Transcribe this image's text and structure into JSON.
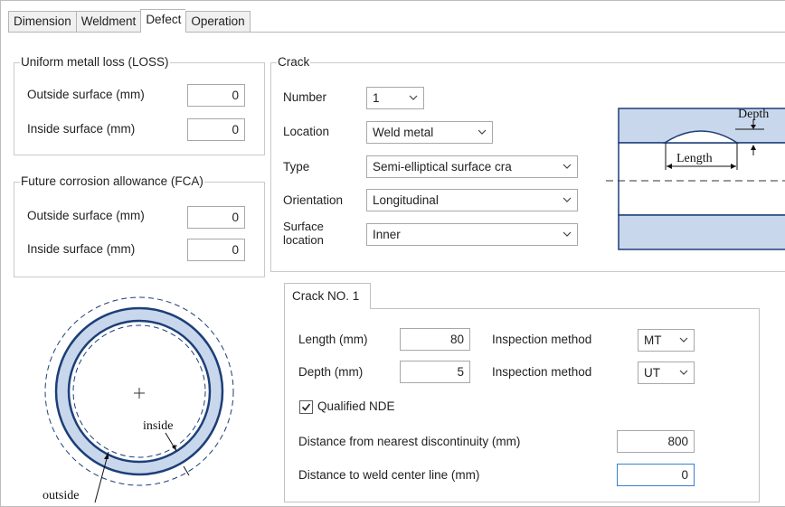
{
  "tabs": [
    "Dimension",
    "Weldment",
    "Defect",
    "Operation"
  ],
  "active_tab": "Defect",
  "loss": {
    "title": "Uniform metall loss (LOSS)",
    "outside_label": "Outside surface (mm)",
    "outside_value": "0",
    "inside_label": "Inside surface (mm)",
    "inside_value": "0"
  },
  "fca": {
    "title": "Future corrosion allowance (FCA)",
    "outside_label": "Outside surface (mm)",
    "outside_value": "0",
    "inside_label": "Inside surface (mm)",
    "inside_value": "0"
  },
  "crack": {
    "title": "Crack",
    "number_label": "Number",
    "number_value": "1",
    "location_label": "Location",
    "location_value": "Weld metal",
    "type_label": "Type",
    "type_value": "Semi-elliptical surface cra",
    "orientation_label": "Orientation",
    "orientation_value": "Longitudinal",
    "surface_label_1": "Surface",
    "surface_label_2": "location",
    "surface_value": "Inner"
  },
  "diagram": {
    "depth_label": "Depth",
    "length_label": "Length",
    "inside_label": "inside",
    "outside_label": "outside"
  },
  "crack_no": {
    "tab_label": "Crack NO. 1",
    "length_label": "Length (mm)",
    "length_value": "80",
    "depth_label": "Depth (mm)",
    "depth_value": "5",
    "inspection_label_1": "Inspection method",
    "inspection_value_1": "MT",
    "inspection_label_2": "Inspection method",
    "inspection_value_2": "UT",
    "qualified_label": "Qualified NDE",
    "qualified_checked": true,
    "discontinuity_label": "Distance from nearest discontinuity (mm)",
    "discontinuity_value": "800",
    "weld_distance_label": "Distance to weld center line (mm)",
    "weld_distance_value": "0"
  },
  "colors": {
    "pipe_fill": "#c9d7ec",
    "pipe_stroke": "#1c3f78",
    "focus_border": "#3b7fd1"
  }
}
